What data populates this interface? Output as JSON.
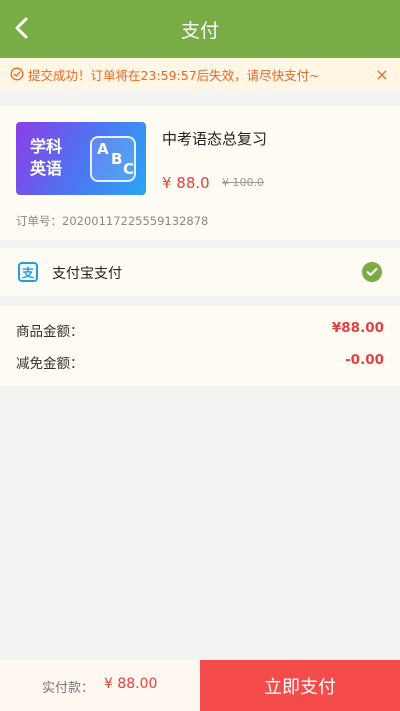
{
  "header": {
    "title": "支付",
    "back_icon": "chevron-left-icon"
  },
  "notice": {
    "text": "提交成功！订单将在23:59:57后失效，请尽快支付~",
    "close": "×"
  },
  "product": {
    "thumb_subject_line1": "学科",
    "thumb_subject_line2": "英语",
    "thumb_letters": [
      "A",
      "B",
      "C"
    ],
    "title": "中考语态总复习",
    "price": "¥ 88.0",
    "original_price": "¥ 100.0",
    "order_no": "订单号：20200117225559132878"
  },
  "payment": {
    "label": "支付宝支付",
    "icon_char": "支"
  },
  "amounts": {
    "goods_label": "商品金额：",
    "goods_value": "¥88.00",
    "discount_label": "减免金额：",
    "discount_value": "-0.00"
  },
  "footer": {
    "due_label": "实付款：",
    "due_value": "¥ 88.00",
    "pay_button": "立即支付"
  },
  "colors": {
    "brand_green": "#7aac45",
    "accent_red": "#f54b4b",
    "notice_orange": "#e8692b"
  }
}
